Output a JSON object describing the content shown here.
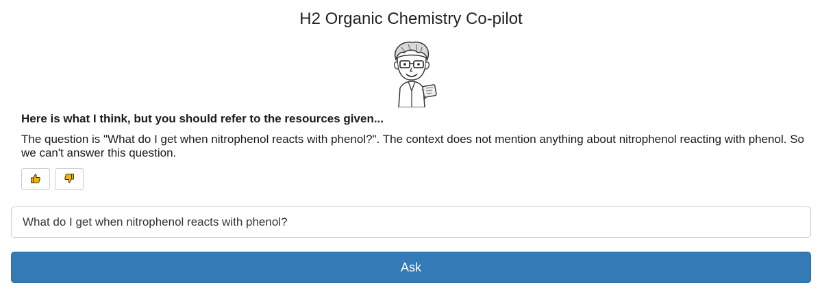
{
  "app": {
    "title": "H2 Organic Chemistry Co-pilot"
  },
  "avatar": {
    "icon": "cartoon-scientist-icon"
  },
  "answer": {
    "heading": "Here is what I think, but you should refer to the resources given...",
    "body": "The question is \"What do I get when nitrophenol reacts with phenol?\". The context does not mention anything about nitrophenol reacting with phenol. So we can't answer this question."
  },
  "feedback": {
    "thumbs_up_icon": "thumbs-up-icon",
    "thumbs_down_icon": "thumbs-down-icon",
    "icon_color": "#f5b400"
  },
  "question_input": {
    "value": "What do I get when nitrophenol reacts with phenol?"
  },
  "ask_button": {
    "label": "Ask",
    "color": "#337ab7"
  }
}
